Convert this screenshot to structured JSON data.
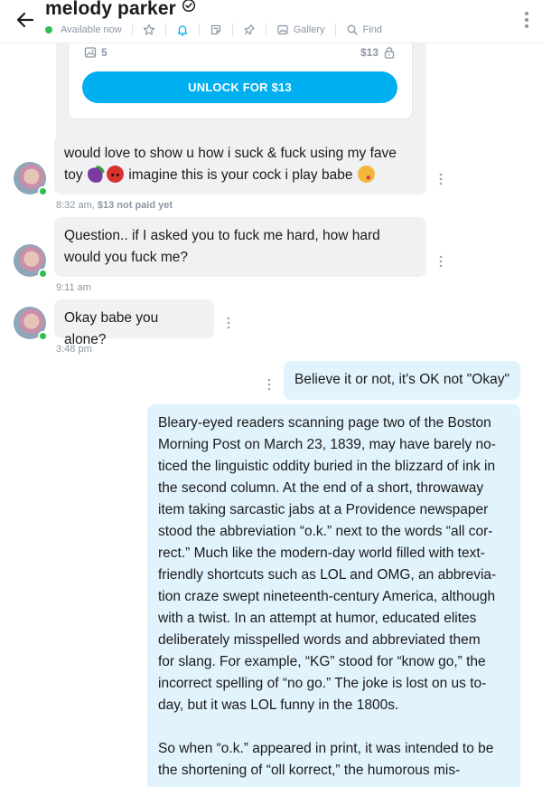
{
  "header": {
    "title": "melody parker",
    "status": "Available now",
    "gallery_label": "Gallery",
    "find_label": "Find"
  },
  "locked_post": {
    "media_count": "5",
    "price": "$13",
    "unlock_label": "UNLOCK FOR $13"
  },
  "messages": [
    {
      "text_line1": "would love to show u how i suck & fuck using my fave",
      "text_line2_a": "toy",
      "text_line2_b": "imagine this is your cock i play babe",
      "time": "8:32 am,",
      "paid_note": "$13 not paid yet",
      "emojis": [
        "eggplant",
        "smiling-devil",
        "winking-kiss"
      ]
    },
    {
      "text_line1": "Question.. if I asked you to fuck me hard, how hard",
      "text_line2": "would you fuck me?",
      "time": "9:11 am"
    },
    {
      "text": "Okay babe you alone?",
      "time": "3:48 pm"
    }
  ],
  "outgoing": [
    {
      "text": "Believe it or not, it's OK not \"Okay\""
    },
    {
      "text": "Bleary-eyed readers scanning page two of the Boston\nMorning Post on March 23, 1839, may have barely no-\nticed the linguistic oddity buried in the blizzard of ink in\nthe second column. At the end of a short, throwaway\nitem taking sarcastic jabs at a Providence newspaper\nstood the abbreviation “o.k.” next to the words “all cor-\nrect.” Much like the modern-day world filled with text-\nfriendly shortcuts such as LOL and OMG, an abbrevia-\ntion craze swept nineteenth-century America, although\nwith a twist. In an attempt at humor, educated elites\ndeliberately misspelled words and abbreviated them\nfor slang. For example, “KG” stood for “know go,” the\nincorrect spelling of “no go.” The joke is lost on us to-\nday, but it was LOL funny in the 1800s.\n\nSo when “o.k.” appeared in print, it was intended to be\nthe shortening of “oll korrect,” the humorous mis-"
    }
  ],
  "colors": {
    "accent": "#00aff0",
    "online": "#2fbf4f",
    "incoming_bubble": "#f0f1f3",
    "outgoing_bubble": "#e1f3fc"
  }
}
